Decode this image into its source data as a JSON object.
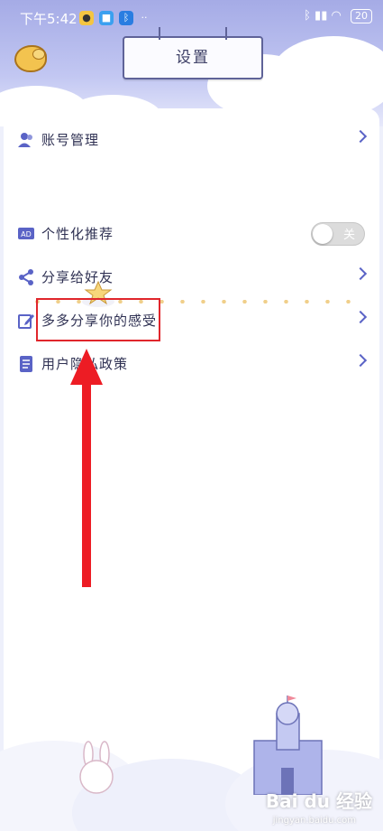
{
  "status_bar": {
    "time": "下午5:42",
    "battery": "20",
    "icons": [
      "notification-icon",
      "app-icon",
      "bluetooth-icon",
      "more-icon",
      "signal-icon",
      "wifi-icon"
    ]
  },
  "header": {
    "title": "设置"
  },
  "settings": {
    "items": [
      {
        "label": "账号管理",
        "icon": "account-icon"
      },
      {
        "label": "个性化推荐",
        "icon": "ad-icon",
        "toggle": "关"
      },
      {
        "label": "分享给好友",
        "icon": "share-icon"
      },
      {
        "label": "多多分享你的感受",
        "icon": "edit-icon"
      },
      {
        "label": "用户隐私政策",
        "icon": "document-icon"
      }
    ]
  },
  "watermark": {
    "brand": "Bai du 经验",
    "url": "jingyan.baidu.com"
  },
  "colors": {
    "accent": "#5a63c6",
    "header": "#a5abe6",
    "annotation": "#e0262c"
  }
}
